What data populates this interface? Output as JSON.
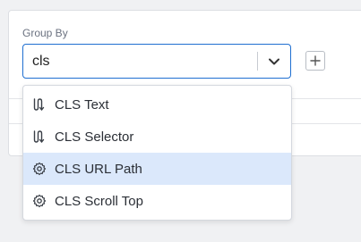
{
  "group_by": {
    "label": "Group By",
    "input_value": "cls"
  },
  "menu": {
    "items": [
      {
        "label": "CLS Text",
        "icon": "text-fields-icon",
        "selected": false
      },
      {
        "label": "CLS Selector",
        "icon": "text-fields-icon",
        "selected": false
      },
      {
        "label": "CLS URL Path",
        "icon": "gear-icon",
        "selected": true
      },
      {
        "label": "CLS Scroll Top",
        "icon": "gear-icon",
        "selected": false
      }
    ]
  },
  "colors": {
    "accent": "#1f6fd1",
    "selected_bg": "#dbe8fb"
  }
}
